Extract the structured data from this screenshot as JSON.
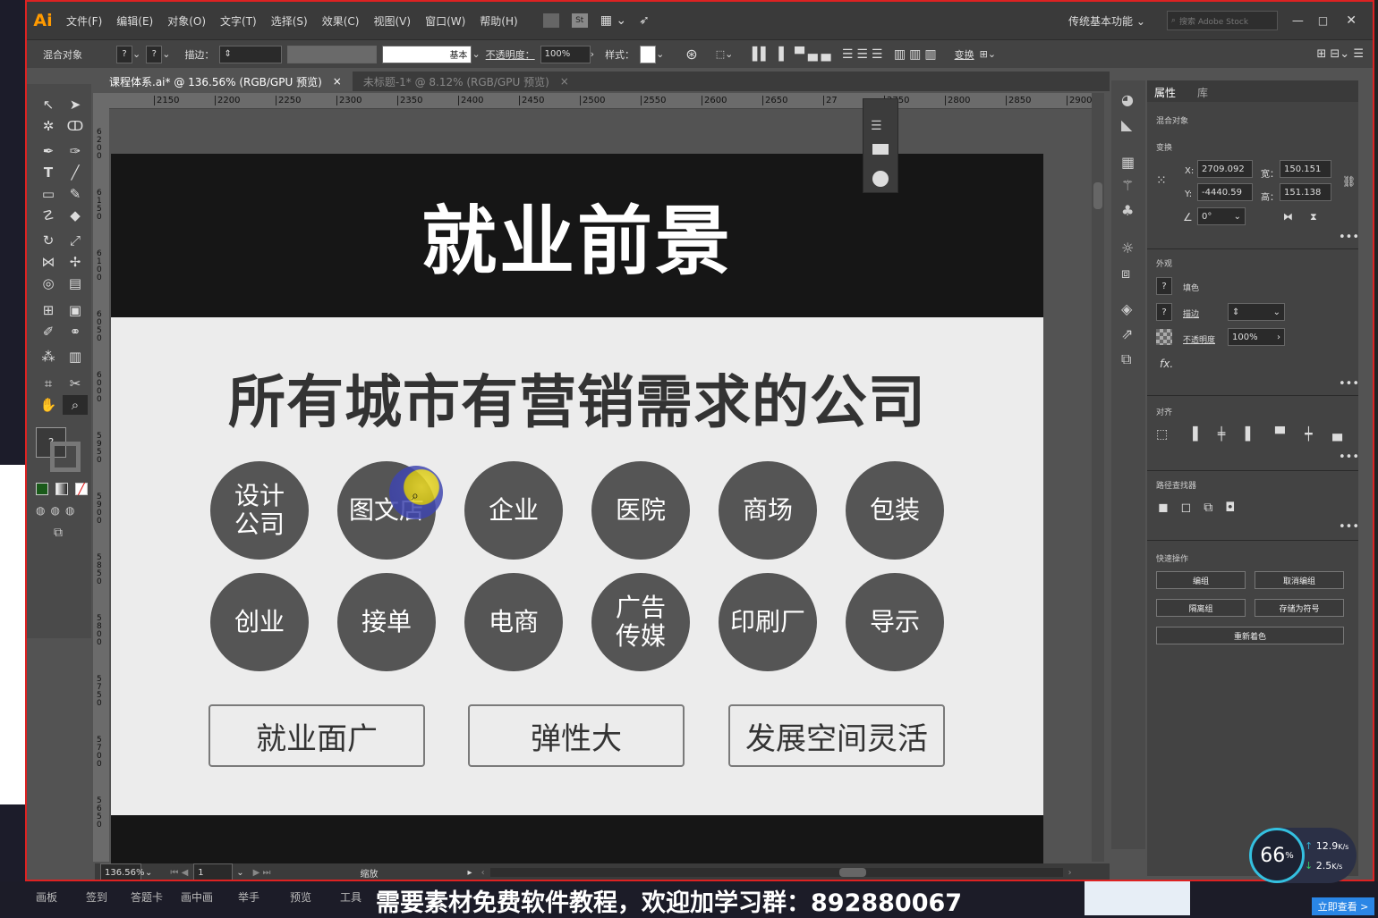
{
  "app": {
    "logo": "Ai"
  },
  "menu": [
    "文件(F)",
    "编辑(E)",
    "对象(O)",
    "文字(T)",
    "选择(S)",
    "效果(C)",
    "视图(V)",
    "窗口(W)",
    "帮助(H)"
  ],
  "menubar_right": {
    "workspace": "传统基本功能",
    "search_placeholder": "搜索 Adobe Stock"
  },
  "controlbar": {
    "selection_label": "混合对象",
    "stroke_label": "描边：",
    "stroke_style": "基本",
    "opacity_label": "不透明度：",
    "opacity_value": "100%",
    "style_label": "样式：",
    "transform_label": "变换"
  },
  "tabs": [
    {
      "label": "课程体系.ai* @ 136.56% (RGB/GPU 预览)",
      "close": "×"
    },
    {
      "label": "未标题-1* @ 8.12% (RGB/GPU 预览)",
      "close": "×"
    }
  ],
  "ruler_h": [
    "2150",
    "2200",
    "2250",
    "2300",
    "2350",
    "2400",
    "2450",
    "2500",
    "2550",
    "2600",
    "2650",
    "27",
    "2750",
    "2800",
    "2850",
    "2900"
  ],
  "ruler_v": [
    "6\n2\n0\n0",
    "6\n1\n5\n0",
    "6\n1\n0\n0",
    "6\n0\n5\n0",
    "6\n0\n0\n0",
    "5\n9\n5\n0",
    "5\n9\n0\n0",
    "5\n8\n5\n0",
    "5\n8\n0\n0",
    "5\n7\n5\n0",
    "5\n7\n0\n0",
    "5\n6\n5\n0"
  ],
  "canvas": {
    "title": "就业前景",
    "subtitle": "所有城市有营销需求的公司",
    "circles_row1": [
      "设计\n公司",
      "图文店",
      "企业",
      "医院",
      "商场",
      "包装"
    ],
    "circles_row2": [
      "创业",
      "接单",
      "电商",
      "广告\n传媒",
      "印刷厂",
      "导示"
    ],
    "pills": [
      "就业面广",
      "弹性大",
      "发展空间灵活"
    ]
  },
  "panel": {
    "tabs": [
      "属性",
      "库"
    ],
    "object_type": "混合对象",
    "transform_title": "变换",
    "x_label": "X:",
    "x_value": "2709.092",
    "y_label": "Y:",
    "y_value": "-4440.59",
    "w_label": "宽：",
    "w_value": "150.151",
    "h_label": "高：",
    "h_value": "151.138",
    "angle_value": "0°",
    "appearance_title": "外观",
    "fill_label": "填色",
    "stroke_label": "描边",
    "opacity_label": "不透明度",
    "opacity_value": "100%",
    "fx_label": "fx.",
    "align_title": "对齐",
    "pathfinder_title": "路径查找器",
    "quick_title": "快速操作",
    "quick_buttons": [
      "编组",
      "取消编组",
      "隔离组",
      "存储为符号",
      "重新着色"
    ]
  },
  "statusbar": {
    "zoom": "136.56%",
    "artboard": "1",
    "tool": "缩放"
  },
  "taskbar": {
    "items": [
      "画板",
      "签到",
      "答题卡",
      "画中画",
      "举手",
      "预览",
      "工具"
    ],
    "caption": "需要素材免费软件教程，欢迎加学习群：892880067",
    "view_now": "立即查看 >"
  },
  "net": {
    "percent": "66",
    "percent_unit": "%",
    "up": "12.9",
    "up_unit": "K/s",
    "down": "2.5",
    "down_unit": "K/s"
  },
  "colors": {
    "accent": "#ff9a00",
    "banner": "#161616",
    "circle": "#555555",
    "artboard": "#ececec",
    "frame": "#dd2222"
  }
}
